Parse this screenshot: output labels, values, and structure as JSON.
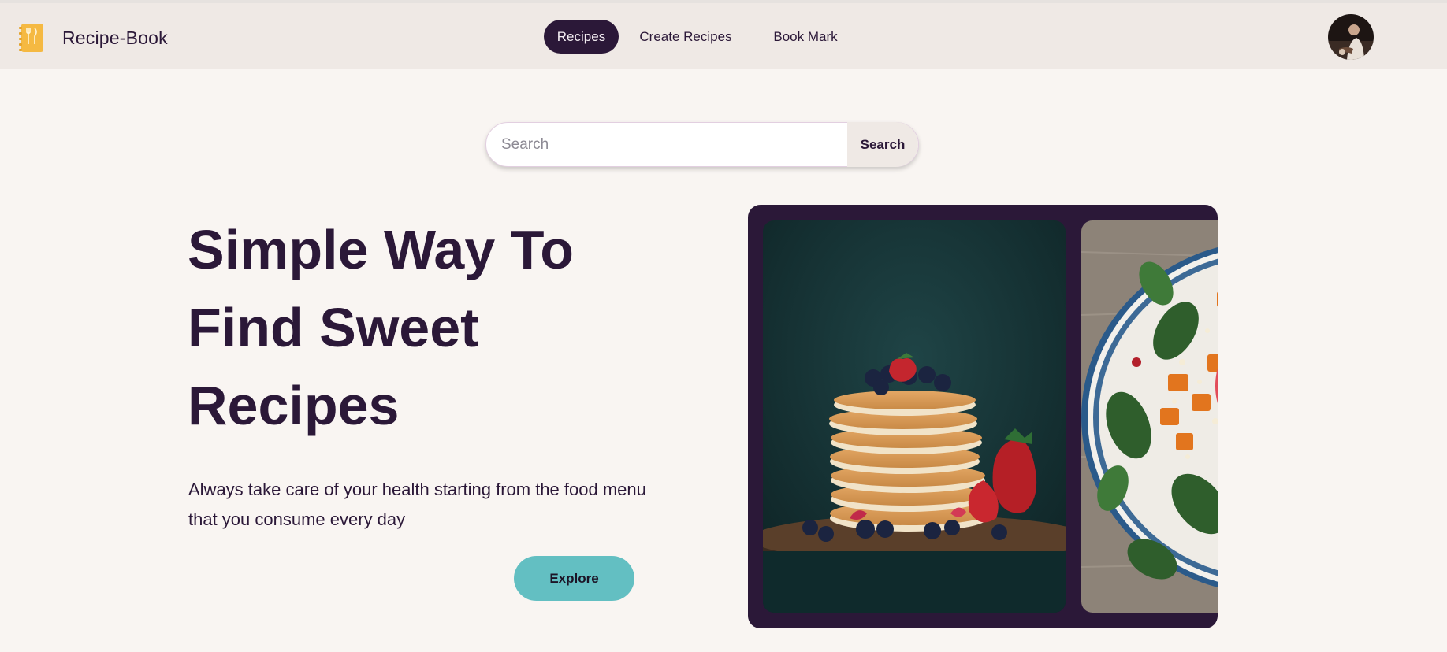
{
  "nav": {
    "brand": "Recipe-Book",
    "items": [
      {
        "label": "Recipes",
        "active": true
      },
      {
        "label": "Create Recipes",
        "active": false
      },
      {
        "label": "Book Mark",
        "active": false
      }
    ],
    "icons": {
      "logo": "recipe-book-icon",
      "avatar": "user-avatar"
    }
  },
  "search": {
    "placeholder": "Search",
    "value": "",
    "button_label": "Search"
  },
  "hero": {
    "title_lines": [
      "Simple Way To",
      "Find Sweet",
      "Recipes"
    ],
    "subtitle_lines": [
      "Always take care of your health starting from the food menu",
      "that you consume every day"
    ],
    "cta_label": "Explore"
  },
  "gallery": {
    "images": [
      "pancake-stack-photo",
      "salad-bowl-photo"
    ]
  },
  "colors": {
    "primary": "#2b1838",
    "accent": "#63bfc2",
    "navbar_bg": "#efe9e5",
    "page_bg": "#f9f5f2"
  }
}
